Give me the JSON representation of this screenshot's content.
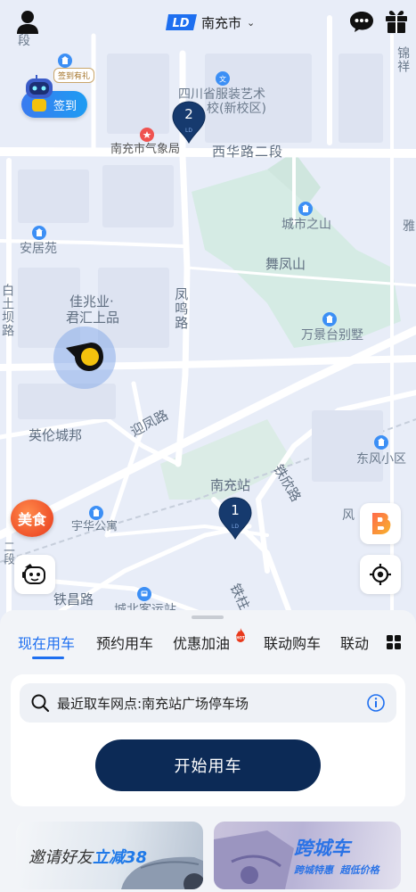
{
  "topbar": {
    "city": "南充市",
    "brand_logo_text": "LD"
  },
  "signin": {
    "label": "签到",
    "badge": "签到有礼"
  },
  "map": {
    "labels": {
      "duan": "段",
      "jinxiang": "锦祥",
      "fuzhuang": "四川省服装艺术",
      "fuzhuang2": "校(新校区)",
      "qixiangju": "南充市气象局",
      "xihua": "西华路二段",
      "chengshi": "城市之山",
      "ya": "雅",
      "anjuyuan": "安居苑",
      "wufeng": "舞凤山",
      "baitu": "白土坝路",
      "jiazhao": "佳兆业·",
      "junhui": "君汇上品",
      "fengming": "凤鸣路",
      "wanjing": "万景台别墅",
      "yinglun": "英伦城邦",
      "yingfeng": "迎凤路",
      "dongfeng": "东风小区",
      "tiexin": "铁欣路",
      "nanchongzhan": "南充站",
      "yuhua": "宇华公寓",
      "feng": "风",
      "tiechang": "铁昌路",
      "tiezhu": "铁柱",
      "erduan": "二段",
      "chengbei": "城北客运站"
    },
    "clusters": [
      {
        "count": "2"
      },
      {
        "count": "1"
      }
    ],
    "food_label": "美食"
  },
  "tabs": {
    "items": [
      "现在用车",
      "预约用车",
      "优惠加油",
      "联动购车",
      "联动"
    ],
    "active_index": 0
  },
  "search": {
    "text": "最近取车网点:南充站广场停车场"
  },
  "start_button": {
    "label": "开始用车"
  },
  "banners": {
    "left_prefix": "邀请好友",
    "left_highlight": "立减38",
    "right_title": "跨城车",
    "right_sub1": "跨城特惠",
    "right_sub2": "超低价格"
  },
  "colors": {
    "accent": "#1e6ff0",
    "start_button_bg": "#0c2a56",
    "map_bg": "#e9eef9",
    "food_red": "#e8391c"
  },
  "icons": {
    "user": "user-icon",
    "chat": "chat-icon",
    "gift": "gift-icon",
    "search": "search-icon",
    "info": "info-icon",
    "locate": "locate-icon",
    "grid": "grid-icon"
  }
}
